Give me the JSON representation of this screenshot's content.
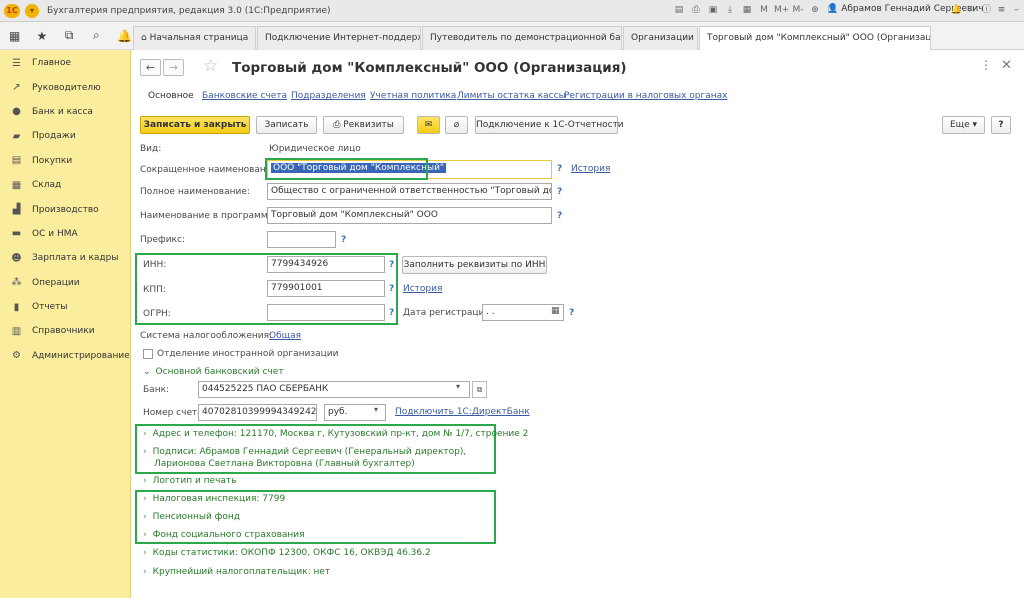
{
  "window": {
    "title": "Бухгалтерия предприятия, редакция 3.0  (1С:Предприятие)",
    "user": "Абрамов Геннадий Сергеевич"
  },
  "tabs": [
    {
      "label": "Начальная страница"
    },
    {
      "label": "Подключение Интернет-поддержки"
    },
    {
      "label": "Путеводитель по демонстрационной базе"
    },
    {
      "label": "Организации"
    },
    {
      "label": "Торговый дом \"Комплексный\" ООО (Организация)"
    }
  ],
  "sidebar": {
    "items": [
      {
        "label": "Главное",
        "icon": "menu-icon"
      },
      {
        "label": "Руководителю",
        "icon": "trend-icon"
      },
      {
        "label": "Банк и касса",
        "icon": "ruble-icon"
      },
      {
        "label": "Продажи",
        "icon": "cart-icon"
      },
      {
        "label": "Покупки",
        "icon": "bag-icon"
      },
      {
        "label": "Склад",
        "icon": "warehouse-icon"
      },
      {
        "label": "Производство",
        "icon": "factory-icon"
      },
      {
        "label": "ОС и НМА",
        "icon": "asset-icon"
      },
      {
        "label": "Зарплата и кадры",
        "icon": "people-icon"
      },
      {
        "label": "Операции",
        "icon": "operations-icon"
      },
      {
        "label": "Отчеты",
        "icon": "reports-icon"
      },
      {
        "label": "Справочники",
        "icon": "books-icon"
      },
      {
        "label": "Администрирование",
        "icon": "gear-icon"
      }
    ]
  },
  "form": {
    "title": "Торговый дом \"Комплексный\" ООО (Организация)",
    "subtabs": {
      "main": "Основное",
      "bank_accounts": "Банковские счета",
      "departments": "Подразделения",
      "accounting_policy": "Учетная политика",
      "cash_limits": "Лимиты остатка кассы",
      "tax_registrations": "Регистрации в налоговых органах"
    },
    "toolbar": {
      "save_close": "Записать и закрыть",
      "save": "Записать",
      "requisites": "Реквизиты",
      "reporting": "Подключение к 1С-Отчетности",
      "more": "Еще"
    },
    "fields": {
      "kind_label": "Вид:",
      "kind_value": "Юридическое лицо",
      "short_name_label": "Сокращенное наименование:",
      "short_name_value": "ООО \"Торговый дом \"Комплексный\"",
      "full_name_label": "Полное наименование:",
      "full_name_value": "Общество с ограниченной ответственностью \"Торговый дом \"Комп.",
      "program_name_label": "Наименование в программе:",
      "program_name_value": "Торговый дом \"Комплексный\" ООО",
      "prefix_label": "Префикс:",
      "prefix_value": "",
      "inn_label": "ИНН:",
      "inn_value": "7799434926",
      "kpp_label": "КПП:",
      "kpp_value": "779901001",
      "ogrn_label": "ОГРН:",
      "ogrn_value": "",
      "reg_date_label": "Дата регистрации:",
      "reg_date_value": " .  .",
      "tax_system_label": "Система налогообложения:",
      "tax_system_value": "Общая",
      "foreign_branch_label": "Отделение иностранной организации",
      "history_link": "История",
      "fill_by_inn_button": "Заполнить реквизиты по ИНН"
    },
    "bank": {
      "section_title": "Основной банковский счет",
      "bank_label": "Банк:",
      "bank_value": "044525225 ПАО СБЕРБАНК",
      "account_label": "Номер счета:",
      "account_value": "40702810399994349242",
      "currency_value": "руб.",
      "direct_bank_link": "Подключить 1С:ДиректБанк"
    },
    "sections": {
      "address": "Адрес и телефон: 121170, Москва г, Кутузовский пр-кт, дом № 1/7, строение 2",
      "signatures_line1": "Подписи: Абрамов Геннадий Сергеевич (Генеральный директор),",
      "signatures_line2": "Ларионова Светлана Викторовна (Главный бухгалтер)",
      "logo": "Логотип и печать",
      "tax_office": "Налоговая инспекция: 7799",
      "pension_fund": "Пенсионный фонд",
      "social_fund": "Фонд социального страхования",
      "stat_codes": "Коды статистики: ОКОПФ 12300, ОКФС 16, ОКВЭД 46.36.2",
      "largest_taxpayer": "Крупнейший налогоплательщик: нет"
    },
    "question_mark": "?"
  },
  "colors": {
    "sidebar_bg": "#fbed9e",
    "primary_button": "#f3cb16",
    "highlight_frame": "#2aa84a",
    "link": "#3b5aa1",
    "section_text": "#2a7a2a"
  }
}
